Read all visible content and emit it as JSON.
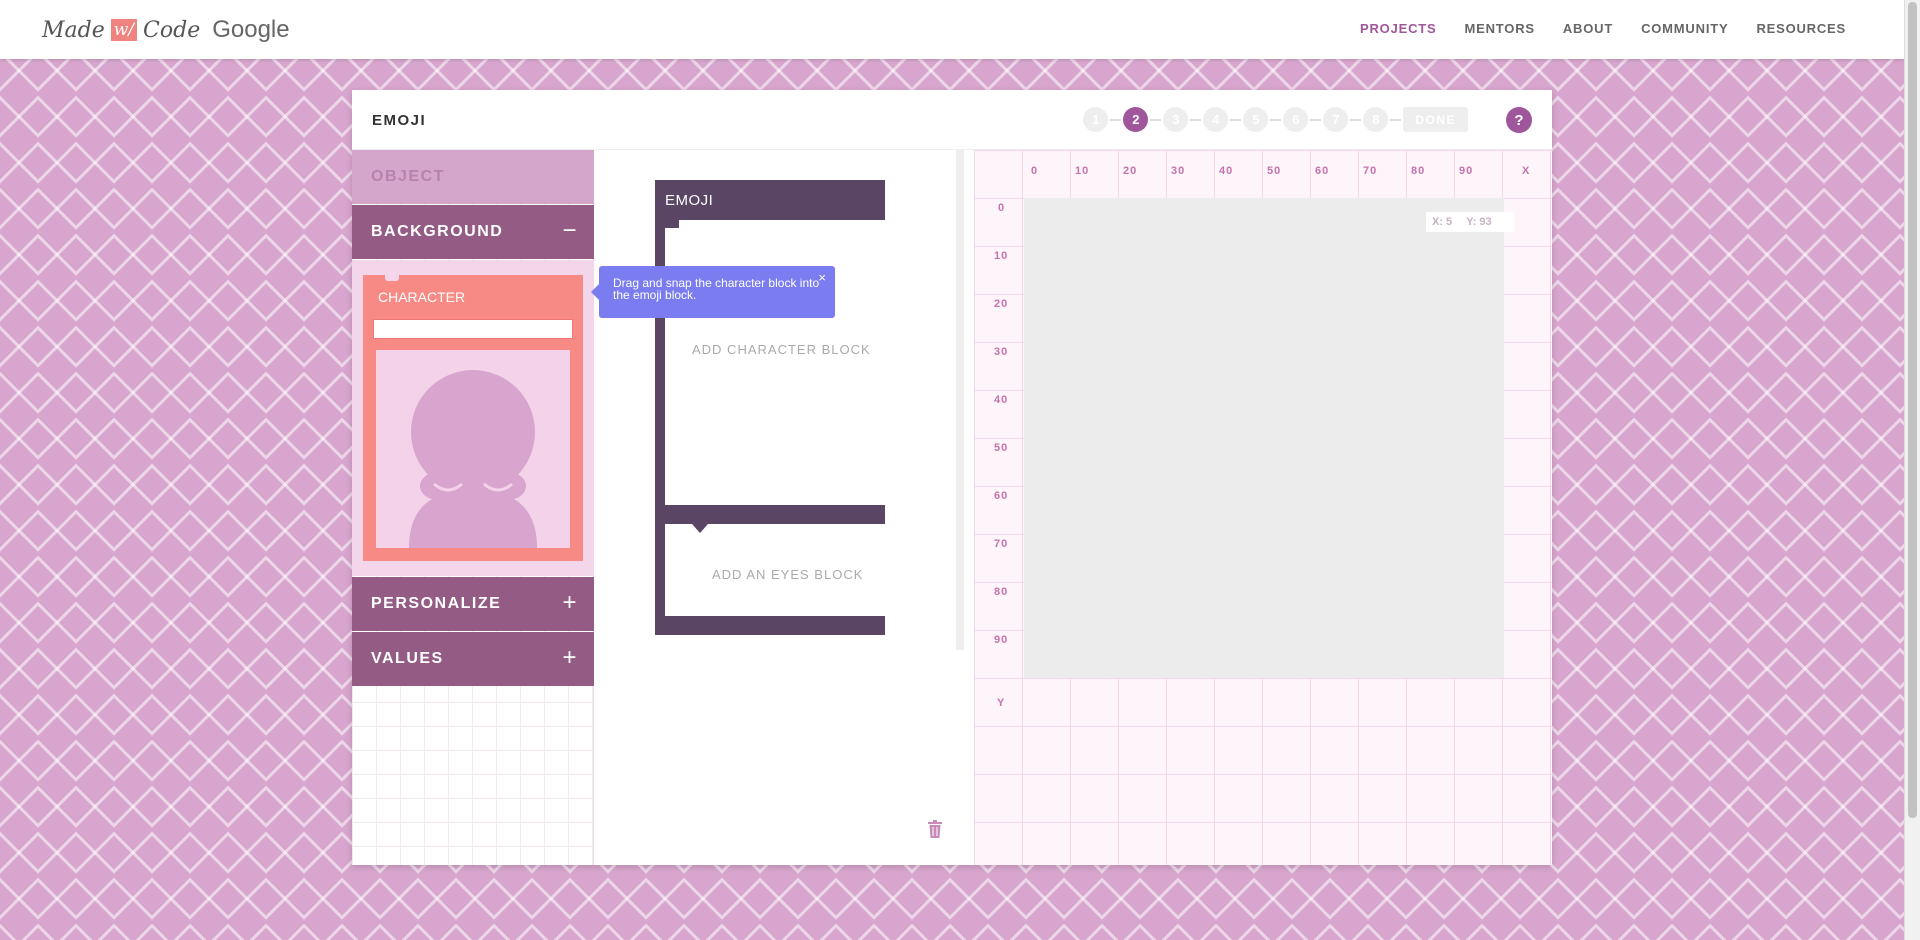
{
  "header": {
    "logo": {
      "made": "Made",
      "w": "w/",
      "code": "Code",
      "google": "Google"
    },
    "nav": [
      {
        "label": "PROJECTS",
        "active": true
      },
      {
        "label": "MENTORS"
      },
      {
        "label": "ABOUT"
      },
      {
        "label": "COMMUNITY"
      },
      {
        "label": "RESOURCES"
      }
    ]
  },
  "panel": {
    "title": "EMOJI",
    "steps": [
      "1",
      "2",
      "3",
      "4",
      "5",
      "6",
      "7",
      "8"
    ],
    "active_step": "2",
    "done_label": "DONE",
    "help_label": "?"
  },
  "sidebar": {
    "categories": {
      "object": "OBJECT",
      "background": "BACKGROUND",
      "personalize": "PERSONALIZE",
      "values": "VALUES"
    },
    "toggles": {
      "background": "−",
      "personalize": "+",
      "values": "+"
    },
    "character_block": {
      "label": "CHARACTER",
      "value": ""
    }
  },
  "workspace": {
    "emoji_block_label": "EMOJI",
    "placeholder_character": "ADD CHARACTER BLOCK",
    "placeholder_eyes": "ADD AN EYES BLOCK"
  },
  "tooltip": {
    "text": "Drag and snap the character block into the emoji block.",
    "close": "×"
  },
  "grid": {
    "x_labels": [
      "0",
      "10",
      "20",
      "30",
      "40",
      "50",
      "60",
      "70",
      "80",
      "90",
      "X"
    ],
    "y_labels": [
      "0",
      "10",
      "20",
      "30",
      "40",
      "50",
      "60",
      "70",
      "80",
      "90",
      "Y"
    ],
    "coords": {
      "x": "X: 5",
      "y": "Y: 93"
    }
  },
  "colors": {
    "accent": "#a0569a",
    "category": "#945b85",
    "character_block": "#f78a85",
    "emoji_block": "#5b4564",
    "tooltip": "#7b7cf0"
  }
}
